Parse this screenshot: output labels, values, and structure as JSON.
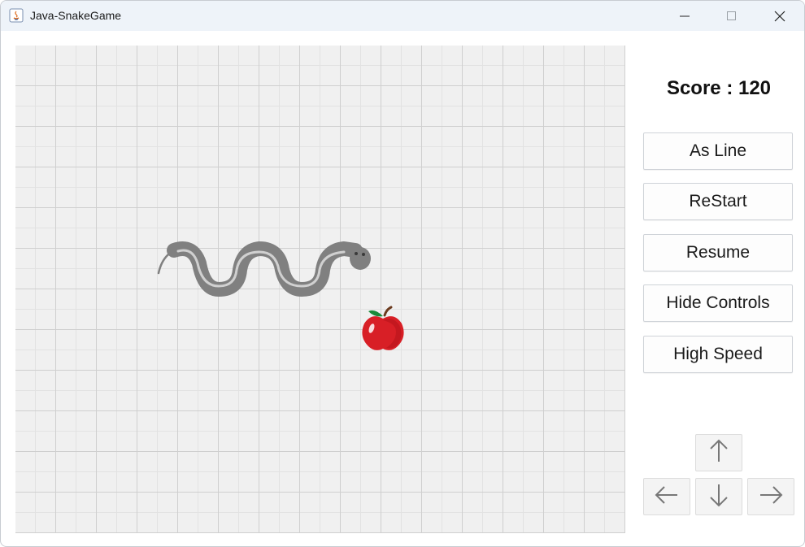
{
  "window": {
    "title": "Java-SnakeGame",
    "controls": [
      "minimize-icon",
      "maximize-icon",
      "close-icon"
    ]
  },
  "game": {
    "snake_color": "#808080",
    "apple_icon": "apple-icon",
    "grid_background": "#f0f0f0"
  },
  "sidebar": {
    "score_label": "Score : 120",
    "buttons": {
      "as_line": "As Line",
      "restart": "ReStart",
      "resume": "Resume",
      "hide_controls": "Hide Controls",
      "high_speed": "High Speed"
    },
    "arrows": [
      "arrow-up-icon",
      "arrow-left-icon",
      "arrow-down-icon",
      "arrow-right-icon"
    ]
  }
}
